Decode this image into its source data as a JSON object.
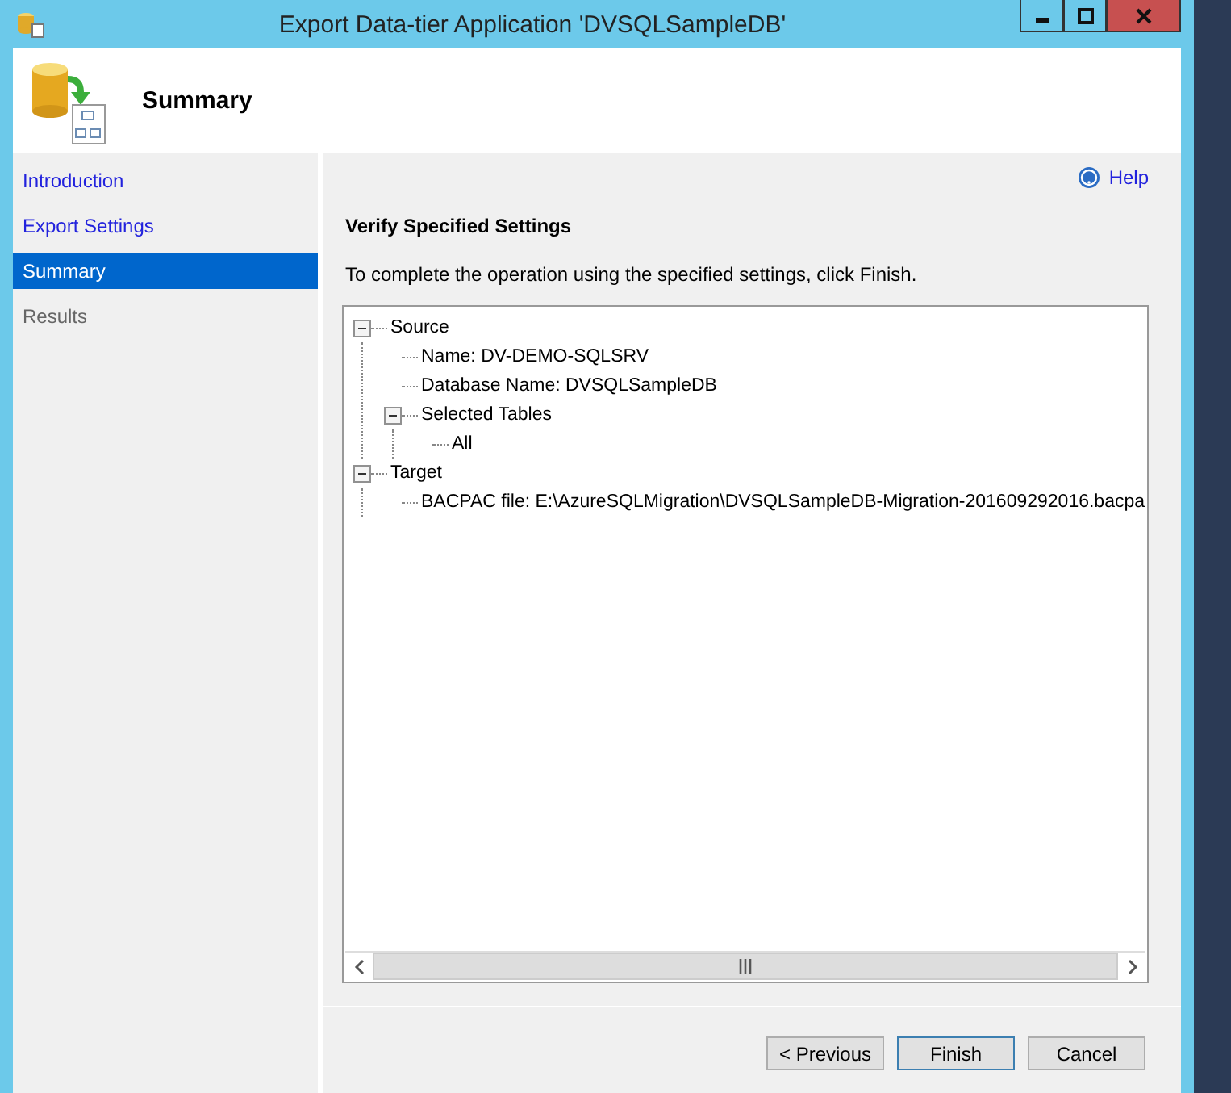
{
  "window": {
    "title": "Export Data-tier Application 'DVSQLSampleDB'"
  },
  "header": {
    "title": "Summary"
  },
  "sidebar": {
    "items": [
      {
        "label": "Introduction",
        "selected": false,
        "disabled": false
      },
      {
        "label": "Export Settings",
        "selected": false,
        "disabled": false
      },
      {
        "label": "Summary",
        "selected": true,
        "disabled": false
      },
      {
        "label": "Results",
        "selected": false,
        "disabled": true
      }
    ]
  },
  "help": {
    "label": "Help"
  },
  "content": {
    "heading": "Verify Specified Settings",
    "description": "To complete the operation using the specified settings, click Finish."
  },
  "tree": [
    {
      "label": "Source",
      "expanded": true,
      "children": [
        {
          "label": "Name: DV-DEMO-SQLSRV"
        },
        {
          "label": "Database Name: DVSQLSampleDB"
        },
        {
          "label": "Selected Tables",
          "expanded": true,
          "children": [
            {
              "label": "All"
            }
          ]
        }
      ]
    },
    {
      "label": "Target",
      "expanded": true,
      "children": [
        {
          "label": "BACPAC file: E:\\AzureSQLMigration\\DVSQLSampleDB-Migration-201609292016.bacpa"
        }
      ]
    }
  ],
  "buttons": [
    {
      "label": "< Previous",
      "default": false
    },
    {
      "label": "Finish",
      "default": true
    },
    {
      "label": "Cancel",
      "default": false
    }
  ]
}
